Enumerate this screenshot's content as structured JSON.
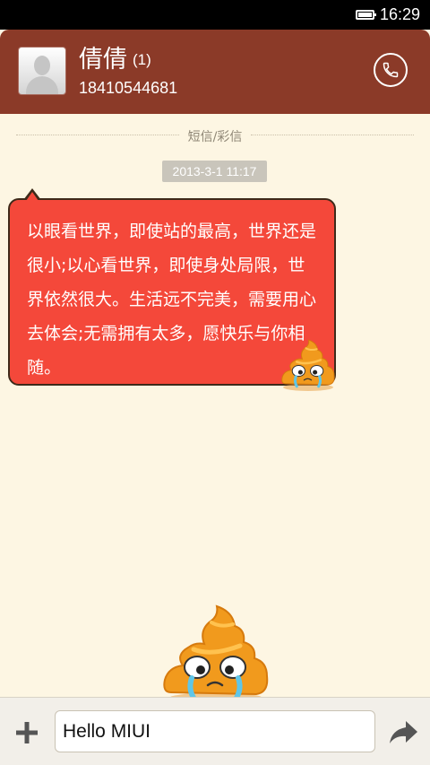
{
  "status_bar": {
    "time": "16:29",
    "battery_icon": "battery-full-icon"
  },
  "header": {
    "contact_name": "倩倩",
    "unread_count": "(1)",
    "phone_number": "18410544681",
    "avatar_icon": "default-avatar-icon",
    "call_icon": "phone-icon",
    "background_color": "#8b3a28"
  },
  "thread": {
    "message_type_label": "短信/彩信",
    "timestamp": "2013-3-1 11:17",
    "messages": [
      {
        "text": "以眼看世界，即使站的最高，世界还是很小;以心看世界，即使身处局限，世界依然很大。生活远不完美，需要用心去体会;无需拥有太多，愿快乐与你相随。",
        "bubble_color": "#f4483a",
        "sticker_icon": "crying-poop-icon"
      }
    ],
    "background_color": "#fdf6e3"
  },
  "composer": {
    "add_icon": "plus-icon",
    "input_value": "Hello MIUI",
    "send_icon": "send-arrow-icon",
    "sticker_icon": "crying-poop-icon"
  }
}
